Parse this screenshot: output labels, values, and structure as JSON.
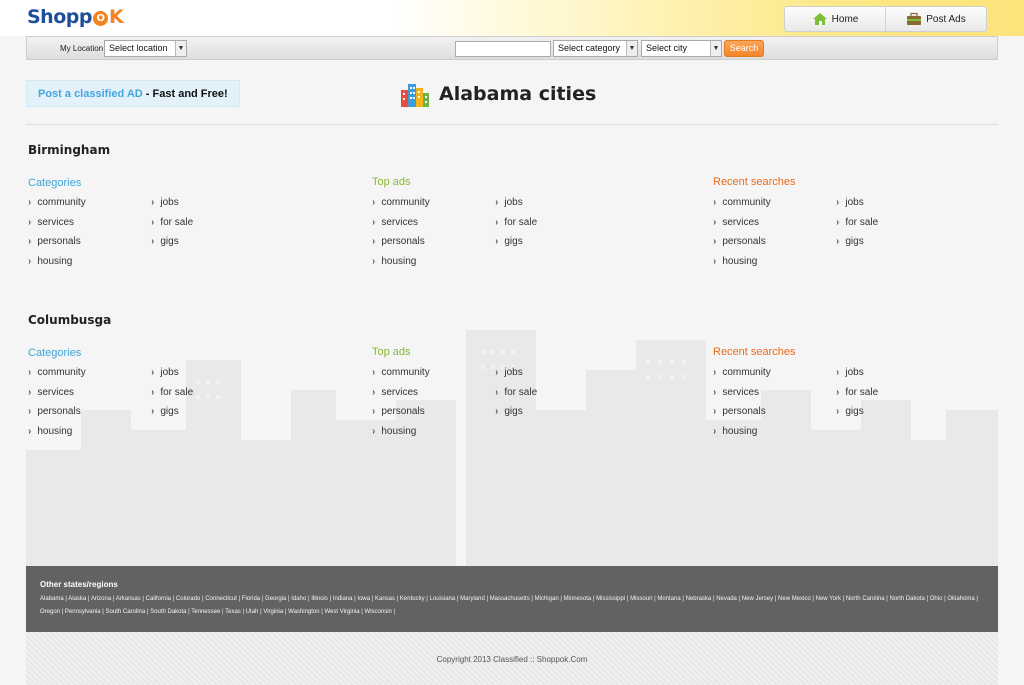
{
  "header": {
    "logo_text_a": "Shopp",
    "logo_text_b": "K",
    "logo_badge": "O",
    "nav": [
      {
        "label": "Home",
        "icon": "home-icon"
      },
      {
        "label": "Post Ads",
        "icon": "briefcase-icon"
      }
    ]
  },
  "searchbar": {
    "location_label": "My Location",
    "location_select": "Select location",
    "keyword_value": "",
    "category_select": "Select category",
    "city_select": "Select city",
    "search_button": "Search"
  },
  "post_ad": {
    "lead": "Post a classified AD",
    "tail": " - Fast and Free!"
  },
  "page_title": "Alabama cities",
  "colors": {
    "blue": "#3ea4d8",
    "green": "#8ab833",
    "orange": "#e86a1d",
    "footer": "#626262"
  },
  "cities": [
    {
      "name": "Birmingham",
      "columns": [
        {
          "heading": "Categories",
          "left": [
            "community",
            "services",
            "personals",
            "housing"
          ],
          "right": [
            "jobs",
            "for sale",
            "gigs"
          ]
        },
        {
          "heading": "Top ads",
          "left": [
            "community",
            "services",
            "personals",
            "housing"
          ],
          "right": [
            "jobs",
            "for sale",
            "gigs"
          ]
        },
        {
          "heading": "Recent searches",
          "left": [
            "community",
            "services",
            "personals",
            "housing"
          ],
          "right": [
            "jobs",
            "for sale",
            "gigs"
          ]
        }
      ]
    },
    {
      "name": "Columbusga",
      "columns": [
        {
          "heading": "Categories",
          "left": [
            "community",
            "services",
            "personals",
            "housing"
          ],
          "right": [
            "jobs",
            "for sale",
            "gigs"
          ]
        },
        {
          "heading": "Top ads",
          "left": [
            "community",
            "services",
            "personals",
            "housing"
          ],
          "right": [
            "jobs",
            "for sale",
            "gigs"
          ]
        },
        {
          "heading": "Recent searches",
          "left": [
            "community",
            "services",
            "personals",
            "housing"
          ],
          "right": [
            "jobs",
            "for sale",
            "gigs"
          ]
        }
      ]
    }
  ],
  "footer": {
    "other_states_title": "Other states/regions",
    "states": [
      "Alabama",
      "Alaska",
      "Arizona",
      "Arkansas",
      "California",
      "Colorado",
      "Connecticut",
      "Florida",
      "Georgia",
      "Idaho",
      "Illinois",
      "Indiana",
      "Iowa",
      "Kansas",
      "Kentucky",
      "Louisiana",
      "Maryland",
      "Massachusetts",
      "Michigan",
      "Minnesota",
      "Mississippi",
      "Missouri",
      "Montana",
      "Nebraska",
      "Nevada",
      "New Jersey",
      "New Mexico",
      "New York",
      "North Carolina",
      "North Dakota",
      "Ohio",
      "Oklahoma",
      "Oregon",
      "Pennsylvania",
      "South Carolina",
      "South Dakota",
      "Tennessee",
      "Texas",
      "Utah",
      "Virginia",
      "Washington",
      "West Virginia",
      "Wisconsin"
    ],
    "copyright": "Copyright 2013 Classified :: Shoppok.Com"
  }
}
